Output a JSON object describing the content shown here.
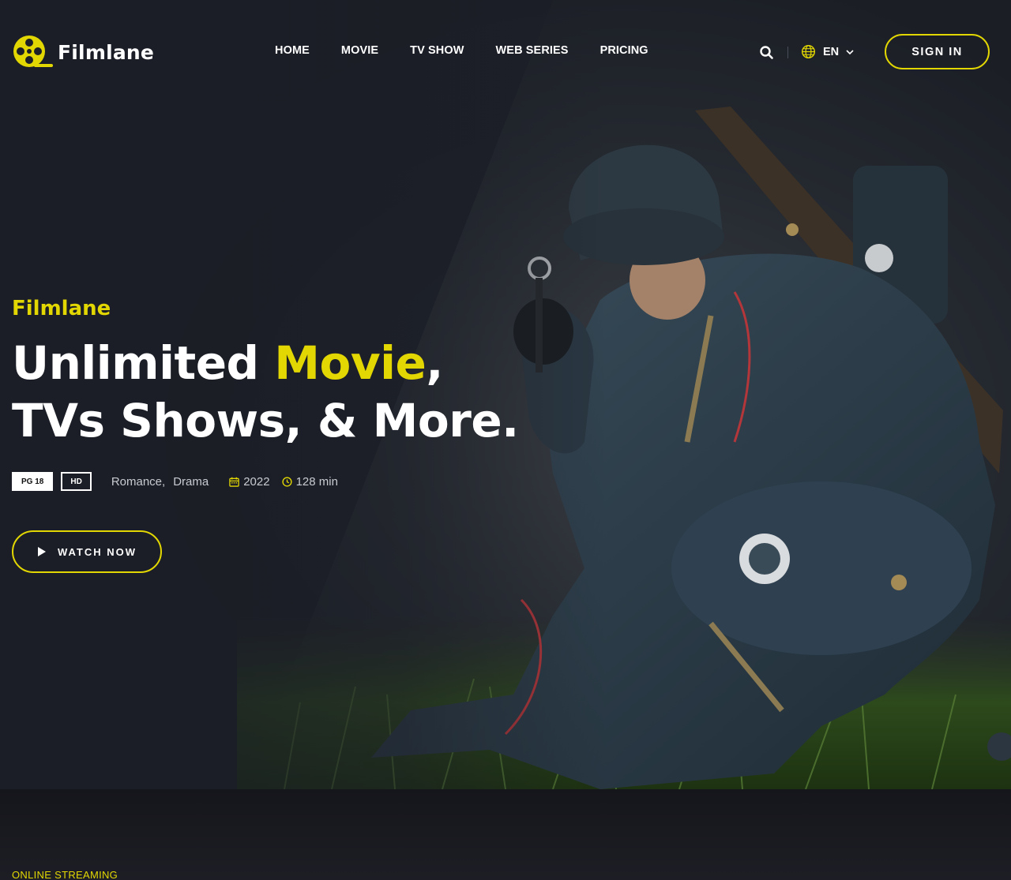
{
  "brand": {
    "name": "Filmlane",
    "accent": "#e2d703"
  },
  "nav": {
    "items": [
      {
        "label": "HOME"
      },
      {
        "label": "MOVIE"
      },
      {
        "label": "TV SHOW"
      },
      {
        "label": "WEB SERIES"
      },
      {
        "label": "PRICING"
      }
    ]
  },
  "header": {
    "search_icon": "search-icon",
    "language": "EN",
    "language_icon": "globe-icon",
    "signin_label": "SIGN IN"
  },
  "hero": {
    "subtitle": "Filmlane",
    "title_part1": "Unlimited ",
    "title_highlight": "Movie",
    "title_part2": ",",
    "title_line2": "TVs Shows, & More.",
    "badge_rating": "PG 18",
    "badge_quality": "HD",
    "genres": [
      "Romance,",
      "Drama"
    ],
    "year": "2022",
    "duration": "128 min",
    "watch_label": "WATCH NOW"
  },
  "section2": {
    "tag": "ONLINE STREAMING"
  }
}
